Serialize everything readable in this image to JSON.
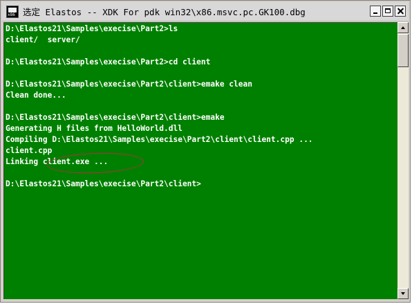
{
  "window": {
    "title": "选定 Elastos -- XDK For pdk win32\\x86.msvc.pc.GK100.dbg",
    "icon_label": "x86"
  },
  "console": {
    "lines": [
      "D:\\Elastos21\\Samples\\execise\\Part2>ls",
      "client/  server/",
      "",
      "D:\\Elastos21\\Samples\\execise\\Part2>cd client",
      "",
      "D:\\Elastos21\\Samples\\execise\\Part2\\client>emake clean",
      "Clean done...",
      "",
      "D:\\Elastos21\\Samples\\execise\\Part2\\client>emake",
      "Generating H files from HelloWorld.dll",
      "Compiling D:\\Elastos21\\Samples\\execise\\Part2\\client\\client.cpp ...",
      "client.cpp",
      "Linking client.exe ...",
      "",
      "D:\\Elastos21\\Samples\\execise\\Part2\\client>"
    ]
  },
  "colors": {
    "console_bg": "#008000",
    "console_fg": "#ffffff",
    "annotation": "#b03040"
  },
  "icons": [
    "console-app-icon",
    "minimize-icon",
    "maximize-icon",
    "close-icon",
    "scroll-up-icon",
    "scroll-down-icon"
  ]
}
